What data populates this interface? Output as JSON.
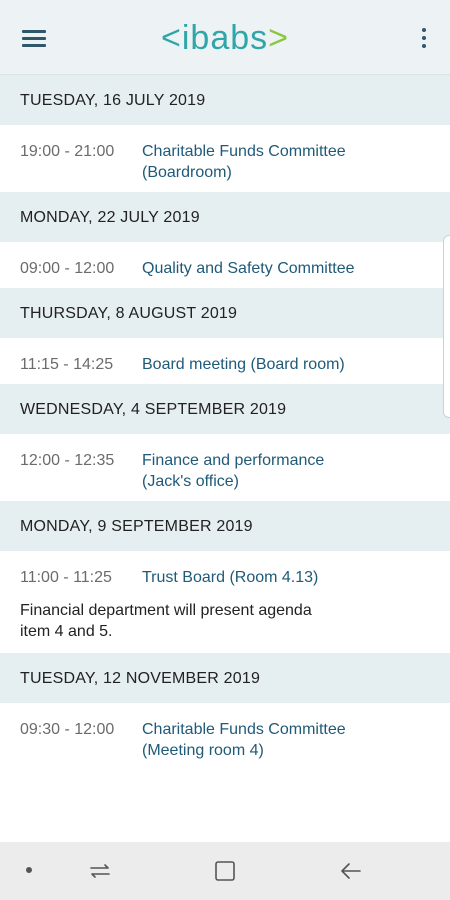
{
  "app": {
    "logo_left": "<",
    "logo_text": "ibabs",
    "logo_right": ">",
    "colors": {
      "accent": "#31a6a8",
      "accent2": "#8cc63f",
      "link": "#1f5a78",
      "header_bg": "#e5eef0"
    }
  },
  "agenda": [
    {
      "date": "TUESDAY, 16 JULY 2019",
      "meetings": [
        {
          "time": "19:00 - 21:00",
          "title": "Charitable Funds Committee\n(Boardroom)",
          "note": ""
        }
      ]
    },
    {
      "date": "MONDAY, 22 JULY 2019",
      "meetings": [
        {
          "time": "09:00 - 12:00",
          "title": "Quality and Safety Committee",
          "note": ""
        }
      ]
    },
    {
      "date": "THURSDAY, 8 AUGUST 2019",
      "meetings": [
        {
          "time": "11:15 - 14:25",
          "title": "Board meeting (Board room)",
          "note": ""
        }
      ]
    },
    {
      "date": "WEDNESDAY, 4 SEPTEMBER 2019",
      "meetings": [
        {
          "time": "12:00 - 12:35",
          "title": "Finance and performance\n(Jack's office)",
          "note": ""
        }
      ]
    },
    {
      "date": "MONDAY, 9 SEPTEMBER 2019",
      "meetings": [
        {
          "time": "11:00 - 11:25",
          "title": "Trust Board (Room 4.13)",
          "note": "Financial department will present agenda\nitem 4 and 5."
        }
      ]
    },
    {
      "date": "TUESDAY, 12 NOVEMBER 2019",
      "meetings": [
        {
          "time": "09:30 - 12:00",
          "title": "Charitable Funds Committee\n(Meeting room 4)",
          "note": ""
        }
      ]
    }
  ],
  "icons": {
    "menu": "hamburger-menu-icon",
    "overflow": "more-vert-icon",
    "recents": "recents-icon",
    "home": "home-icon",
    "back": "back-arrow-icon"
  }
}
